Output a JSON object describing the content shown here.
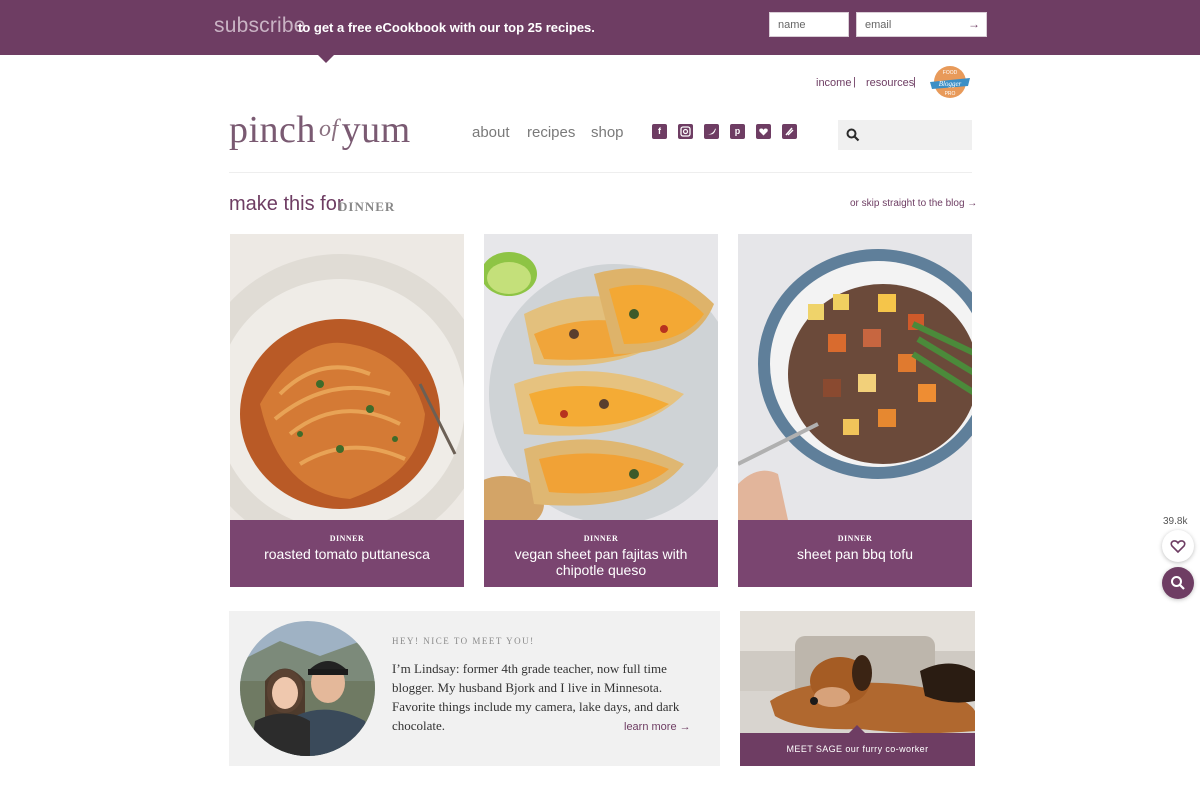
{
  "subscribe": {
    "big": "subscribe",
    "text": "to get a free eCookbook with our top 25 recipes.",
    "name_placeholder": "name",
    "email_placeholder": "email",
    "submit_label": "→"
  },
  "util_links": [
    "income",
    "resources"
  ],
  "util_sep": "|",
  "badge_text": "Food Blogger Pro",
  "logo": {
    "left": "pinch",
    "mid": "of",
    "right": "yum"
  },
  "nav": [
    "about",
    "recipes",
    "shop"
  ],
  "social_icons": [
    "facebook-icon",
    "instagram-icon",
    "twitter-icon",
    "pinterest-icon",
    "bloglovin-icon",
    "feed-icon"
  ],
  "search": {
    "placeholder": ""
  },
  "section": {
    "prefix": "make this for",
    "tag": "DINNER",
    "skip": "or skip straight to the blog →"
  },
  "cards": [
    {
      "category": "DINNER",
      "title": "roasted tomato puttanesca"
    },
    {
      "category": "DINNER",
      "title": "vegan sheet pan fajitas with chipotle queso"
    },
    {
      "category": "DINNER",
      "title": "sheet pan bbq tofu"
    }
  ],
  "about": {
    "hey": "HEY! NICE TO MEET YOU!",
    "bio": "I’m Lindsay: former 4th grade teacher, now full time blogger. My husband Bjork and I live in Minnesota. Favorite things include my camera, lake days, and dark chocolate.",
    "learn_more": "learn more →"
  },
  "sage": {
    "caption": "MEET SAGE our furry co-worker"
  },
  "floating": {
    "count": "39.8k"
  },
  "colors": {
    "brand": "#6e3d63",
    "caption": "#7a4570"
  }
}
